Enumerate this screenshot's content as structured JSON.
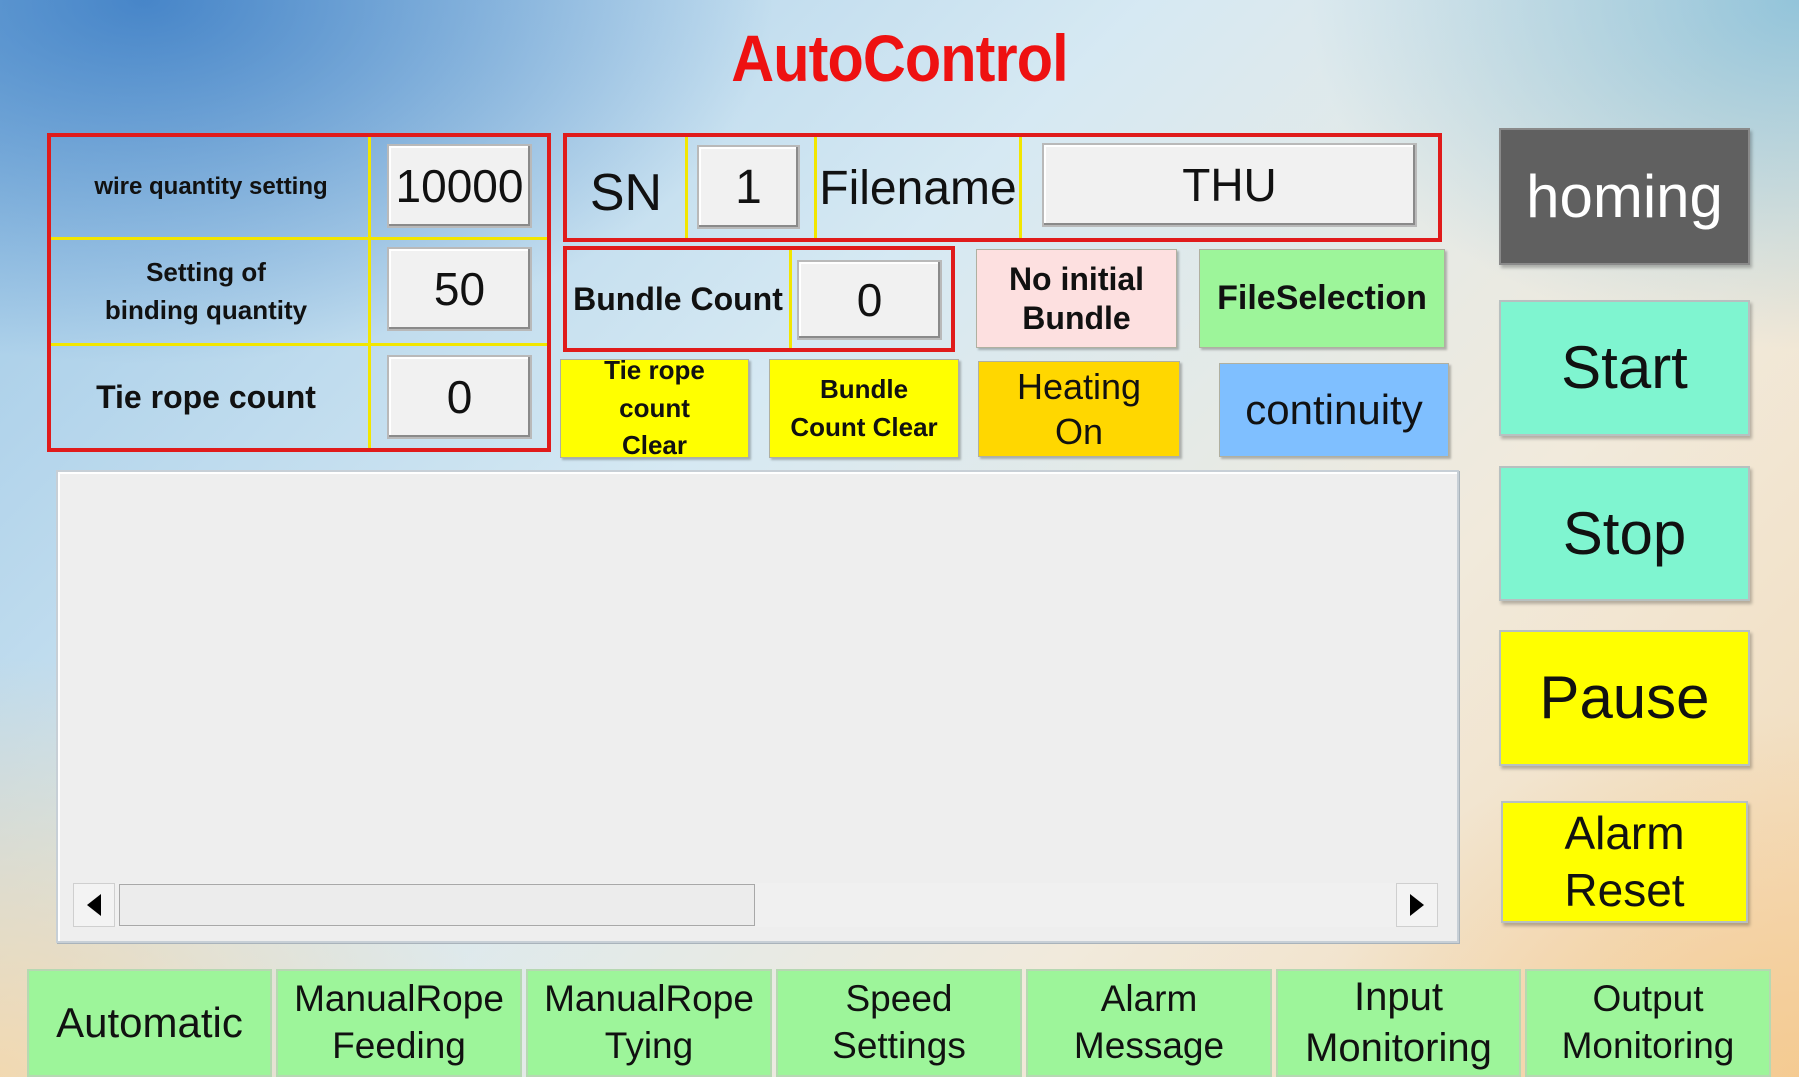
{
  "title": "AutoControl",
  "settings": {
    "wire_quantity_label": "wire quantity setting",
    "wire_quantity_value": "10000",
    "binding_quantity_label": "Setting of binding quantity",
    "binding_quantity_value": "50",
    "tie_rope_count_label": "Tie rope count",
    "tie_rope_count_value": "0"
  },
  "file": {
    "sn_label": "SN",
    "sn_value": "1",
    "filename_label": "Filename",
    "filename_value": "THU"
  },
  "bundle": {
    "label": "Bundle Count",
    "value": "0"
  },
  "actions": {
    "no_initial_bundle": "No initial Bundle",
    "file_selection": "FileSelection",
    "tie_rope_count_clear": "Tie rope count Clear",
    "bundle_count_clear": "Bundle Count Clear",
    "heating_on": "Heating On",
    "continuity": "continuity"
  },
  "side_buttons": {
    "homing": "homing",
    "start": "Start",
    "stop": "Stop",
    "pause": "Pause",
    "alarm_reset": "Alarm Reset"
  },
  "nav": [
    "Automatic",
    "ManualRope Feeding",
    "ManualRope Tying",
    "Speed Settings",
    "Alarm Message",
    "Input Monitoring",
    "Output Monitoring"
  ],
  "colors": {
    "title": "#ee1111",
    "homing": "#606060",
    "start_stop": "#7ff5d0",
    "pause_alarm": "#ffff00",
    "clear_buttons": "#ffff00",
    "heating": "#ffd700",
    "continuity": "#7fbfff",
    "file_selection": "#9df59a",
    "no_initial_bundle": "#fde0e0",
    "nav": "#9df59a"
  },
  "icons": {
    "scroll_left": "triangle-left-icon",
    "scroll_right": "triangle-right-icon"
  }
}
